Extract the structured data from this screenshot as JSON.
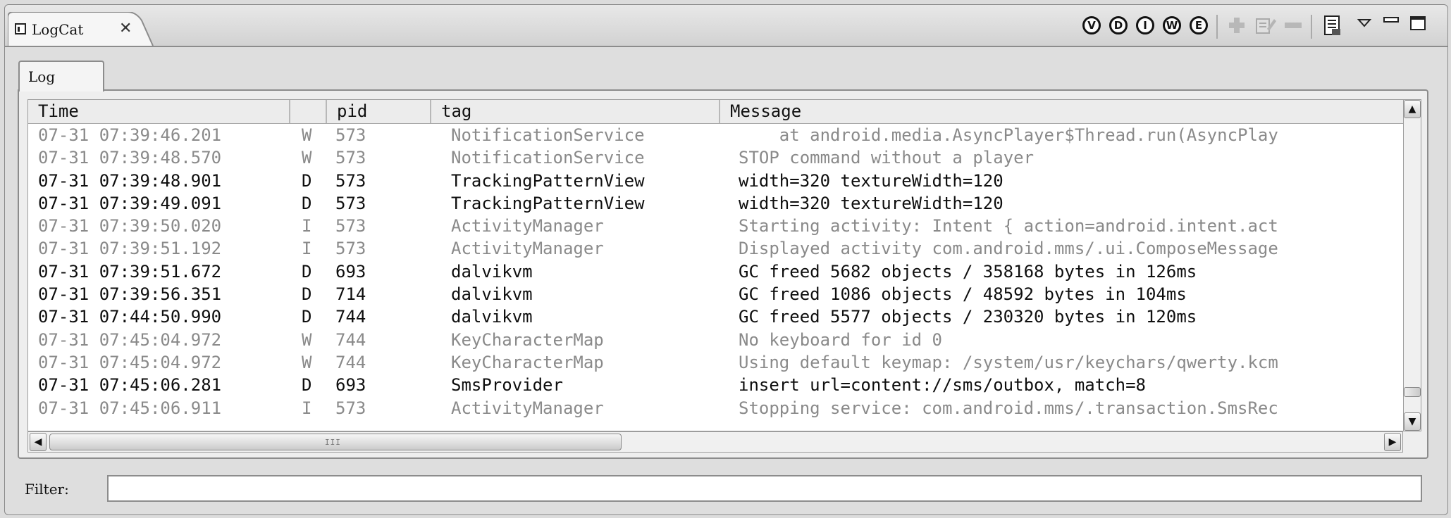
{
  "view_tab": {
    "title": "LogCat",
    "close_glyph": "✕"
  },
  "toolbar": {
    "levels": [
      {
        "label": "V",
        "name": "verbose-filter-button"
      },
      {
        "label": "D",
        "name": "debug-filter-button"
      },
      {
        "label": "I",
        "name": "info-filter-button"
      },
      {
        "label": "W",
        "name": "warn-filter-button"
      },
      {
        "label": "E",
        "name": "error-filter-button"
      }
    ],
    "icons": [
      "add-filter-icon",
      "edit-filter-icon",
      "remove-filter-icon",
      "clear-log-icon",
      "view-menu-icon",
      "minimize-icon",
      "maximize-icon"
    ]
  },
  "log_tab": {
    "label": "Log"
  },
  "table": {
    "headers": {
      "time": "Time",
      "level": "",
      "pid": "pid",
      "tag": "tag",
      "message": "Message"
    },
    "rows": [
      {
        "time": "07-31 07:39:46.201",
        "level": "W",
        "pid": "573",
        "tag": "NotificationService",
        "message": "    at android.media.AsyncPlayer$Thread.run(AsyncPlay",
        "style": "dim"
      },
      {
        "time": "07-31 07:39:48.570",
        "level": "W",
        "pid": "573",
        "tag": "NotificationService",
        "message": "STOP command without a player",
        "style": "dim"
      },
      {
        "time": "07-31 07:39:48.901",
        "level": "D",
        "pid": "573",
        "tag": "TrackingPatternView",
        "message": "width=320 textureWidth=120",
        "style": "bright"
      },
      {
        "time": "07-31 07:39:49.091",
        "level": "D",
        "pid": "573",
        "tag": "TrackingPatternView",
        "message": "width=320 textureWidth=120",
        "style": "bright"
      },
      {
        "time": "07-31 07:39:50.020",
        "level": "I",
        "pid": "573",
        "tag": "ActivityManager",
        "message": "Starting activity: Intent { action=android.intent.act",
        "style": "dim"
      },
      {
        "time": "07-31 07:39:51.192",
        "level": "I",
        "pid": "573",
        "tag": "ActivityManager",
        "message": "Displayed activity com.android.mms/.ui.ComposeMessage",
        "style": "dim"
      },
      {
        "time": "07-31 07:39:51.672",
        "level": "D",
        "pid": "693",
        "tag": "dalvikvm",
        "message": "GC freed 5682 objects / 358168 bytes in 126ms",
        "style": "bright"
      },
      {
        "time": "07-31 07:39:56.351",
        "level": "D",
        "pid": "714",
        "tag": "dalvikvm",
        "message": "GC freed 1086 objects / 48592 bytes in 104ms",
        "style": "bright"
      },
      {
        "time": "07-31 07:44:50.990",
        "level": "D",
        "pid": "744",
        "tag": "dalvikvm",
        "message": "GC freed 5577 objects / 230320 bytes in 120ms",
        "style": "bright"
      },
      {
        "time": "07-31 07:45:04.972",
        "level": "W",
        "pid": "744",
        "tag": "KeyCharacterMap",
        "message": "No keyboard for id 0",
        "style": "dim"
      },
      {
        "time": "07-31 07:45:04.972",
        "level": "W",
        "pid": "744",
        "tag": "KeyCharacterMap",
        "message": "Using default keymap: /system/usr/keychars/qwerty.kcm",
        "style": "dim"
      },
      {
        "time": "07-31 07:45:06.281",
        "level": "D",
        "pid": "693",
        "tag": "SmsProvider",
        "message": "insert url=content://sms/outbox, match=8",
        "style": "bright"
      },
      {
        "time": "07-31 07:45:06.911",
        "level": "I",
        "pid": "573",
        "tag": "ActivityManager",
        "message": "Stopping service: com.android.mms/.transaction.SmsRec",
        "style": "dim"
      }
    ]
  },
  "scrollbars": {
    "grip": "III"
  },
  "filter": {
    "label": "Filter:",
    "value": "",
    "placeholder": ""
  }
}
